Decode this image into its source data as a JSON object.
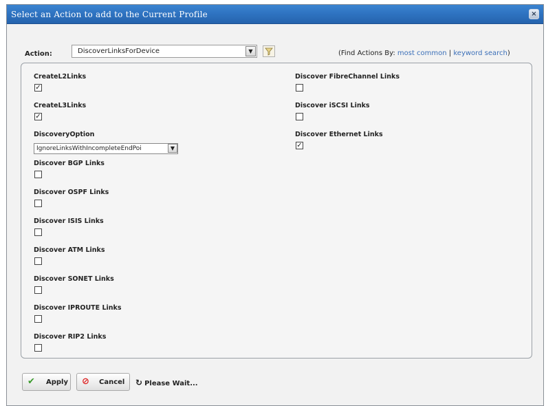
{
  "dialog": {
    "title": "Select an Action to add to the Current Profile",
    "close_glyph": "×"
  },
  "action": {
    "label": "Action:",
    "selected": "DiscoverLinksForDevice",
    "dropdown_glyph": "▼",
    "filter_icon": "filter-icon",
    "find_prefix": "(Find Actions By:",
    "link_most_common": "most common",
    "separator": "|",
    "link_keyword_search": "keyword search",
    "find_suffix": ")"
  },
  "fields_left": [
    {
      "label": "CreateL2Links",
      "type": "checkbox",
      "checked": true
    },
    {
      "label": "CreateL3Links",
      "type": "checkbox",
      "checked": true
    },
    {
      "label": "DiscoveryOption",
      "type": "select",
      "value": "IgnoreLinksWithIncompleteEndPoi"
    },
    {
      "label": "Discover BGP Links",
      "type": "checkbox",
      "checked": false
    },
    {
      "label": "Discover OSPF Links",
      "type": "checkbox",
      "checked": false
    },
    {
      "label": "Discover ISIS Links",
      "type": "checkbox",
      "checked": false
    },
    {
      "label": "Discover ATM Links",
      "type": "checkbox",
      "checked": false
    },
    {
      "label": "Discover SONET Links",
      "type": "checkbox",
      "checked": false
    },
    {
      "label": "Discover IPROUTE Links",
      "type": "checkbox",
      "checked": false
    },
    {
      "label": "Discover RIP2 Links",
      "type": "checkbox",
      "checked": false
    }
  ],
  "fields_right": [
    {
      "label": "Discover FibreChannel Links",
      "type": "checkbox",
      "checked": false
    },
    {
      "label": "Discover iSCSI Links",
      "type": "checkbox",
      "checked": false
    },
    {
      "label": "Discover Ethernet Links",
      "type": "checkbox",
      "checked": true
    }
  ],
  "check_glyph": "✓",
  "footer": {
    "apply_label": "Apply",
    "apply_icon": "checkmark-icon",
    "cancel_label": "Cancel",
    "cancel_icon": "cancel-icon",
    "wait_icon": "refresh-icon",
    "wait_text": "Please Wait..."
  }
}
